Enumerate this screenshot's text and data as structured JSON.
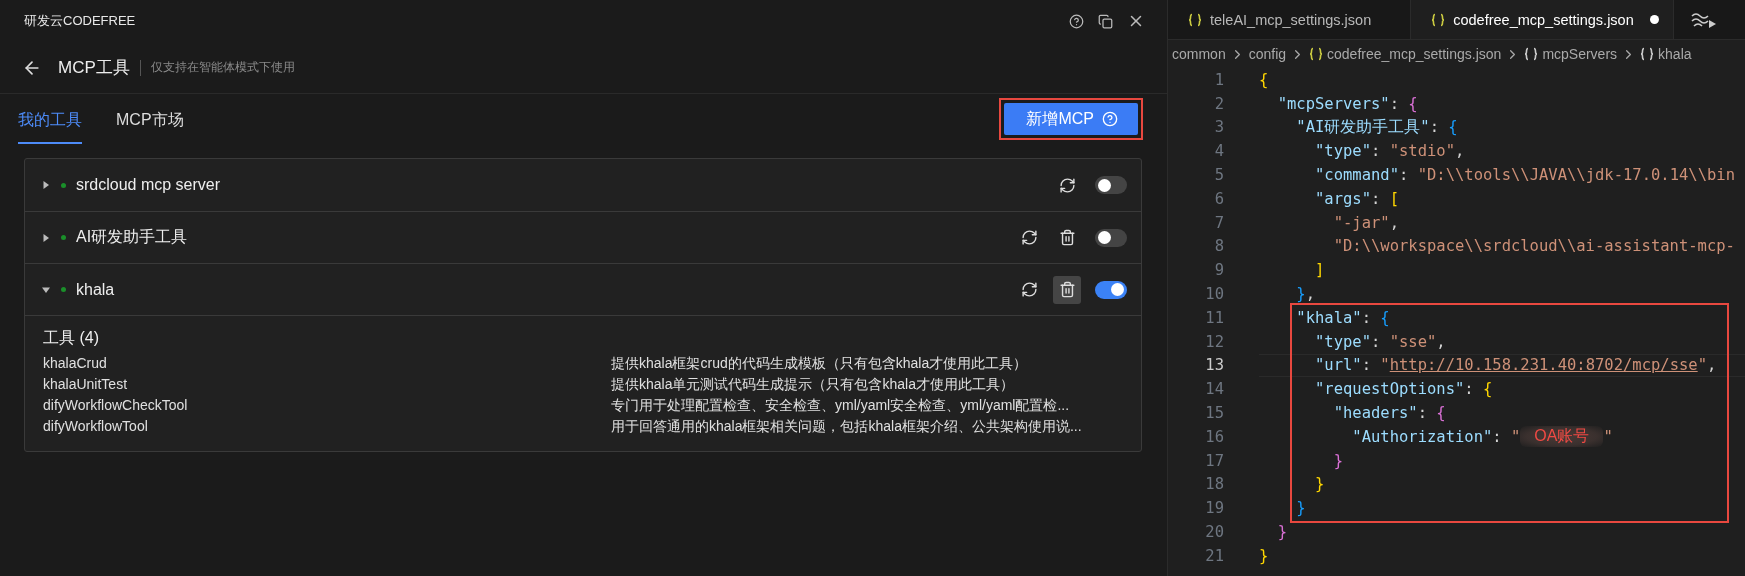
{
  "app": {
    "title": "研发云CODEFREE"
  },
  "header": {
    "title": "MCP工具",
    "note": "仅支持在智能体模式下使用"
  },
  "tabs": [
    {
      "label": "我的工具",
      "selected": true
    },
    {
      "label": "MCP市场",
      "selected": false
    }
  ],
  "add_button": {
    "label": "新增MCP",
    "highlighted": true
  },
  "servers": [
    {
      "name": "srdcloud mcp server",
      "expanded": false,
      "color": "#1a8f2a",
      "deletable": false,
      "enabled": false
    },
    {
      "name": "AI研发助手工具",
      "expanded": false,
      "color": "#1a8f2a",
      "deletable": true,
      "delete_hovered": false,
      "enabled": false
    },
    {
      "name": "khala",
      "expanded": true,
      "color": "#1a8f2a",
      "deletable": true,
      "delete_hovered": true,
      "enabled": true,
      "tools": {
        "heading": "工具 (4)",
        "items": [
          {
            "name": "khalaCrud",
            "description": "提供khala框架crud的代码生成模板（只有包含khala才使用此工具）"
          },
          {
            "name": "khalaUnitTest",
            "description": "提供khala单元测试代码生成提示（只有包含khala才使用此工具）"
          },
          {
            "name": "difyWorkflowCheckTool",
            "description": "专门用于处理配置检查、安全检查、yml/yaml安全检查、yml/yaml配置检..."
          },
          {
            "name": "difyWorkflowTool",
            "description": "用于回答通用的khala框架相关问题，包括khala框架介绍、公共架构使用说..."
          }
        ]
      }
    }
  ],
  "editor": {
    "tabs": [
      {
        "label": "teleAI_mcp_settings.json",
        "selected": false,
        "modified": false
      },
      {
        "label": "codefree_mcp_settings.json",
        "selected": true,
        "modified": true
      }
    ],
    "breadcrumb": [
      {
        "label": "common",
        "kind": "folder"
      },
      {
        "label": "config",
        "kind": "folder"
      },
      {
        "label": "codefree_mcp_settings.json",
        "kind": "file"
      },
      {
        "label": "mcpServers",
        "kind": "object"
      },
      {
        "label": "khala",
        "kind": "object"
      }
    ],
    "blocks": [
      {
        "kind": "plain",
        "lines": [
          {
            "number": "1",
            "current": false,
            "text": "{"
          },
          {
            "number": "2",
            "current": false,
            "text": "  \"mcpServers\": {"
          },
          {
            "number": "3",
            "current": false,
            "text": "    \"AI研发助手工具\": {"
          },
          {
            "number": "4",
            "current": false,
            "text": "      \"type\": \"stdio\","
          },
          {
            "number": "5",
            "current": false,
            "text": "      \"command\": \"D:\\\\tools\\\\JAVA\\\\jdk-17.0.14\\\\bin"
          },
          {
            "number": "6",
            "current": false,
            "text": "      \"args\": ["
          },
          {
            "number": "7",
            "current": false,
            "text": "        \"-jar\","
          },
          {
            "number": "8",
            "current": false,
            "text": "        \"D:\\\\workspace\\\\srdcloud\\\\ai-assistant-mcp-"
          },
          {
            "number": "9",
            "current": false,
            "text": "      ]"
          },
          {
            "number": "10",
            "current": false,
            "text": "    },"
          }
        ]
      },
      {
        "kind": "highlight",
        "lines": [
          {
            "number": "11",
            "current": false,
            "text": "    \"khala\": {"
          },
          {
            "number": "12",
            "current": false,
            "text": "      \"type\": \"sse\","
          },
          {
            "number": "13",
            "current": true,
            "text": "      \"url\": \"http://10.158.231.40:8702/mcp/sse\","
          },
          {
            "number": "14",
            "current": false,
            "text": "      \"requestOptions\": {"
          },
          {
            "number": "15",
            "current": false,
            "text": "        \"headers\": {"
          },
          {
            "number": "16",
            "current": false,
            "text": "          \"Authorization\": \"",
            "redaction": "OA账号",
            "text_end": "\""
          },
          {
            "number": "17",
            "current": false,
            "text": "        }"
          },
          {
            "number": "18",
            "current": false,
            "text": "      }"
          },
          {
            "number": "19",
            "current": false,
            "text": "    }"
          }
        ]
      },
      {
        "kind": "plain",
        "lines": [
          {
            "number": "20",
            "current": false,
            "text": "  }"
          },
          {
            "number": "21",
            "current": false,
            "text": "}"
          }
        ]
      }
    ]
  }
}
